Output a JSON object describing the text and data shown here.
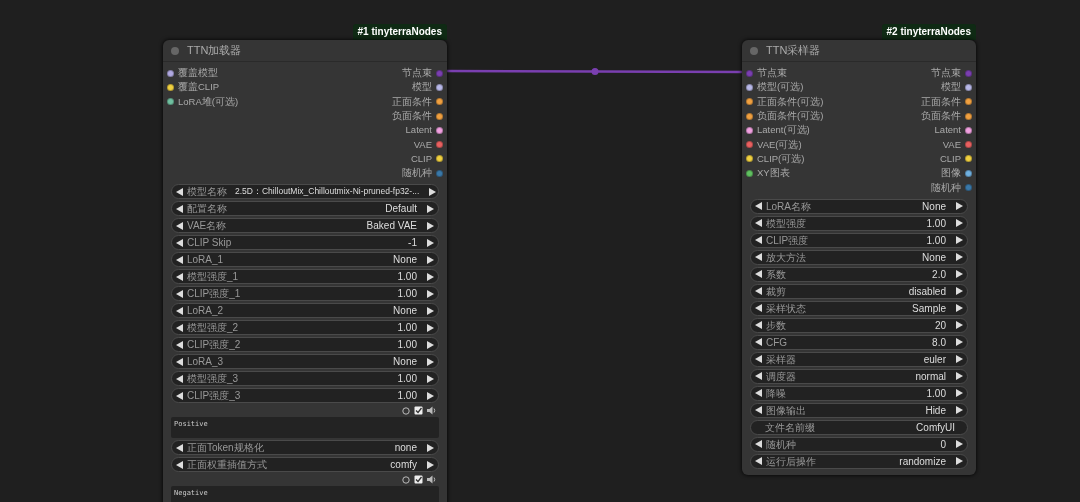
{
  "nodes": [
    {
      "badge": "#1 tinyterraNodes",
      "title": "TTN加载器",
      "inputs": [
        {
          "label": "覆盖模型",
          "color": "#b0a8e0"
        },
        {
          "label": "覆盖CLIP",
          "color": "#f0d040"
        },
        {
          "label": "LoRA堆(可选)",
          "color": "#70c0a0"
        }
      ],
      "outputs": [
        {
          "label": "节点束",
          "color": "#7a3fb0"
        },
        {
          "label": "模型",
          "color": "#b8b8e8"
        },
        {
          "label": "正面条件",
          "color": "#f0a040"
        },
        {
          "label": "负面条件",
          "color": "#f0a040"
        },
        {
          "label": "Latent",
          "color": "#f0a0e0"
        },
        {
          "label": "VAE",
          "color": "#e86060"
        },
        {
          "label": "CLIP",
          "color": "#f0d040"
        },
        {
          "label": "随机种",
          "color": "#3a78a8"
        }
      ],
      "widgets": [
        {
          "kind": "combo",
          "label": "模型名称",
          "value": "2.5D：ChilloutMix_Chilloutmix-Ni-pruned-fp32-..."
        },
        {
          "kind": "combo",
          "label": "配置名称",
          "value": "Default"
        },
        {
          "kind": "combo",
          "label": "VAE名称",
          "value": "Baked VAE"
        },
        {
          "kind": "combo",
          "label": "CLIP Skip",
          "value": "-1"
        },
        {
          "kind": "combo",
          "label": "LoRA_1",
          "value": "None"
        },
        {
          "kind": "combo",
          "label": "模型强度_1",
          "value": "1.00"
        },
        {
          "kind": "combo",
          "label": "CLIP强度_1",
          "value": "1.00"
        },
        {
          "kind": "combo",
          "label": "LoRA_2",
          "value": "None"
        },
        {
          "kind": "combo",
          "label": "模型强度_2",
          "value": "1.00"
        },
        {
          "kind": "combo",
          "label": "CLIP强度_2",
          "value": "1.00"
        },
        {
          "kind": "combo",
          "label": "LoRA_3",
          "value": "None"
        },
        {
          "kind": "combo",
          "label": "模型强度_3",
          "value": "1.00"
        },
        {
          "kind": "combo",
          "label": "CLIP强度_3",
          "value": "1.00"
        },
        {
          "kind": "toggles",
          "checked": true
        },
        {
          "kind": "textarea",
          "value": "Positive"
        },
        {
          "kind": "combo",
          "label": "正面Token规格化",
          "value": "none"
        },
        {
          "kind": "combo",
          "label": "正面权重插值方式",
          "value": "comfy"
        },
        {
          "kind": "toggles",
          "checked": true
        },
        {
          "kind": "textarea",
          "value": "Negative"
        }
      ]
    },
    {
      "badge": "#2 tinyterraNodes",
      "title": "TTN采样器",
      "inputs": [
        {
          "label": "节点束",
          "color": "#7a3fb0"
        },
        {
          "label": "模型(可选)",
          "color": "#b8b8e8"
        },
        {
          "label": "正面条件(可选)",
          "color": "#f0a040"
        },
        {
          "label": "负面条件(可选)",
          "color": "#f0a040"
        },
        {
          "label": "Latent(可选)",
          "color": "#f0a0e0"
        },
        {
          "label": "VAE(可选)",
          "color": "#e86060"
        },
        {
          "label": "CLIP(可选)",
          "color": "#f0d040"
        },
        {
          "label": "XY图表",
          "color": "#60c060"
        }
      ],
      "outputs": [
        {
          "label": "节点束",
          "color": "#7a3fb0"
        },
        {
          "label": "模型",
          "color": "#b8b8e8"
        },
        {
          "label": "正面条件",
          "color": "#f0a040"
        },
        {
          "label": "负面条件",
          "color": "#f0a040"
        },
        {
          "label": "Latent",
          "color": "#f0a0e0"
        },
        {
          "label": "VAE",
          "color": "#e86060"
        },
        {
          "label": "CLIP",
          "color": "#f0d040"
        },
        {
          "label": "图像",
          "color": "#70b0e0"
        },
        {
          "label": "随机种",
          "color": "#3a78a8"
        }
      ],
      "widgets": [
        {
          "kind": "combo",
          "label": "LoRA名称",
          "value": "None"
        },
        {
          "kind": "combo",
          "label": "模型强度",
          "value": "1.00"
        },
        {
          "kind": "combo",
          "label": "CLIP强度",
          "value": "1.00"
        },
        {
          "kind": "combo",
          "label": "放大方法",
          "value": "None"
        },
        {
          "kind": "combo",
          "label": "系数",
          "value": "2.0"
        },
        {
          "kind": "combo",
          "label": "裁剪",
          "value": "disabled"
        },
        {
          "kind": "combo",
          "label": "采样状态",
          "value": "Sample"
        },
        {
          "kind": "combo",
          "label": "步数",
          "value": "20"
        },
        {
          "kind": "combo",
          "label": "CFG",
          "value": "8.0"
        },
        {
          "kind": "combo",
          "label": "采样器",
          "value": "euler"
        },
        {
          "kind": "combo",
          "label": "调度器",
          "value": "normal"
        },
        {
          "kind": "combo",
          "label": "降噪",
          "value": "1.00"
        },
        {
          "kind": "combo",
          "label": "图像输出",
          "value": "Hide"
        },
        {
          "kind": "text",
          "label": "文件名前缀",
          "value": "ComfyUI"
        },
        {
          "kind": "combo",
          "label": "随机种",
          "value": "0"
        },
        {
          "kind": "combo",
          "label": "运行后操作",
          "value": "randomize"
        }
      ]
    }
  ]
}
